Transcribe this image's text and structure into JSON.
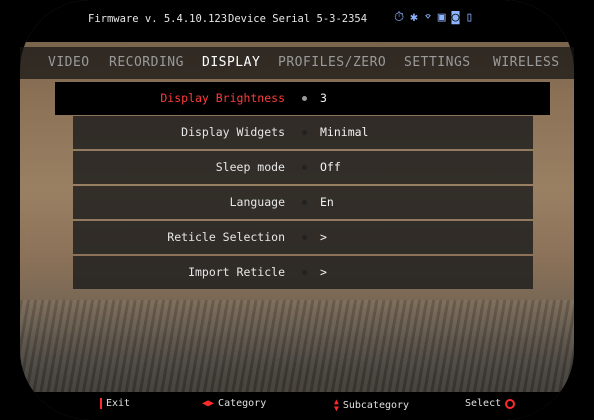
{
  "status": {
    "firmware": "Firmware v. 5.4.10.123",
    "serial": "Device Serial 5-3-2354",
    "icons": [
      "timer-icon",
      "bluetooth-icon",
      "wifi-icon",
      "sd-card-icon",
      "camera-icon",
      "battery-icon"
    ]
  },
  "tabs": [
    {
      "label": "VIDEO"
    },
    {
      "label": "RECORDING"
    },
    {
      "label": "DISPLAY"
    },
    {
      "label": "PROFILES/ZERO"
    },
    {
      "label": "SETTINGS"
    },
    {
      "label": "WIRELESS"
    }
  ],
  "active_tab": "DISPLAY",
  "menu": [
    {
      "label": "Display Brightness",
      "value": "3"
    },
    {
      "label": "Display Widgets",
      "value": "Minimal"
    },
    {
      "label": "Sleep mode",
      "value": "Off"
    },
    {
      "label": "Language",
      "value": "En"
    },
    {
      "label": "Reticle Selection",
      "value": ">"
    },
    {
      "label": "Import Reticle",
      "value": ">"
    }
  ],
  "selected_index": 0,
  "hints": {
    "exit": "Exit",
    "category": "Category",
    "subcategory": "Subcategory",
    "select": "Select"
  },
  "colors": {
    "accent": "#ff2a2a",
    "status_icon": "#8fb4ff"
  }
}
